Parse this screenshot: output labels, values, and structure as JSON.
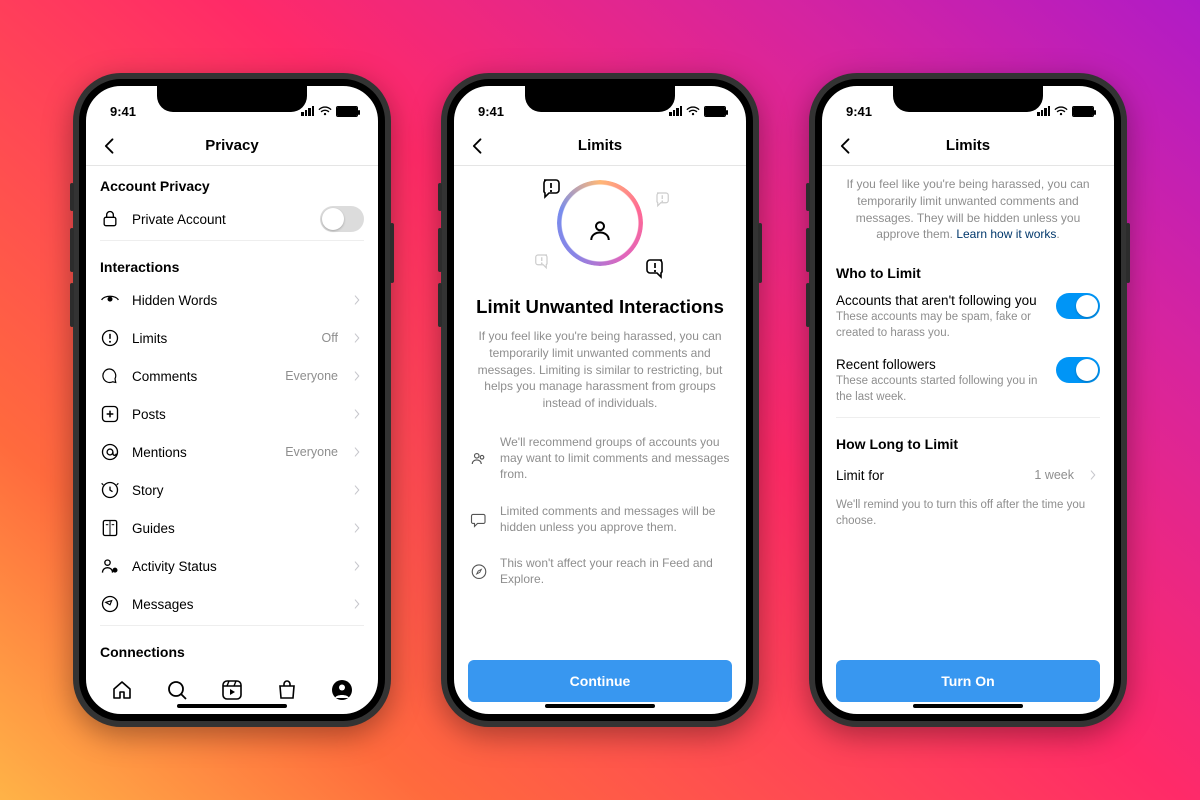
{
  "status": {
    "time": "9:41"
  },
  "screen1": {
    "title": "Privacy",
    "sec_account": "Account Privacy",
    "private_account": "Private Account",
    "sec_interactions": "Interactions",
    "rows": {
      "hidden_words": "Hidden Words",
      "limits": "Limits",
      "limits_value": "Off",
      "comments": "Comments",
      "comments_value": "Everyone",
      "posts": "Posts",
      "mentions": "Mentions",
      "mentions_value": "Everyone",
      "story": "Story",
      "guides": "Guides",
      "activity_status": "Activity Status",
      "messages": "Messages"
    },
    "sec_connections": "Connections"
  },
  "screen2": {
    "title": "Limits",
    "hero_title": "Limit Unwanted Interactions",
    "hero_text": "If you feel like you're being harassed, you can temporarily limit unwanted comments and messages. Limiting is similar to restricting, but helps you manage harassment from groups instead of individuals.",
    "bullets": {
      "b1": "We'll recommend groups of accounts you may want to limit comments and messages from.",
      "b2": "Limited comments and messages will be hidden unless you approve them.",
      "b3": "This won't affect your reach in Feed and Explore."
    },
    "cta": "Continue"
  },
  "screen3": {
    "title": "Limits",
    "info": "If you feel like you're being harassed, you can temporarily limit unwanted comments and messages. They will be hidden unless you approve them. ",
    "info_link": "Learn how it works",
    "sec_who": "Who to Limit",
    "opt1_title": "Accounts that aren't following you",
    "opt1_sub": "These accounts may be spam, fake or created to harass you.",
    "opt2_title": "Recent followers",
    "opt2_sub": "These accounts started following you in the last week.",
    "sec_how": "How Long to Limit",
    "limit_for": "Limit for",
    "limit_value": "1 week",
    "reminder": "We'll remind you to turn this off after the time you choose.",
    "cta": "Turn On"
  }
}
